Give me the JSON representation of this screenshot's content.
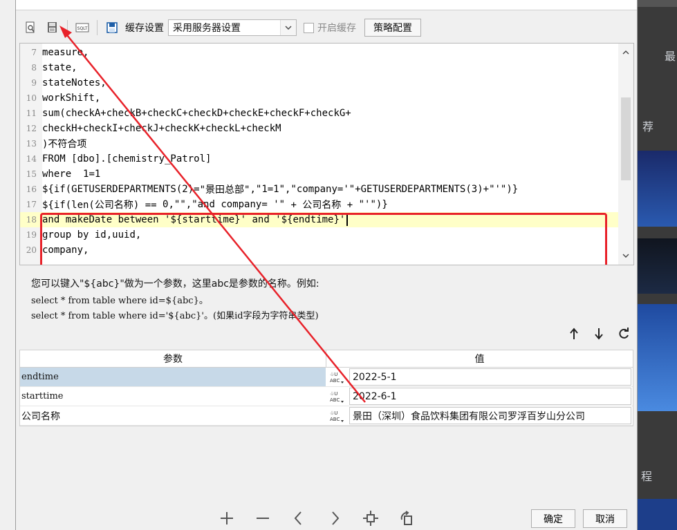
{
  "toolbar": {
    "cache_label": "缓存设置",
    "cache_select": "采用服务器设置",
    "enable_cache": "开启缓存",
    "strategy_button": "策略配置",
    "sql_icon_text": "SQLT"
  },
  "editor": {
    "lines": [
      {
        "n": "7",
        "text": "measure,"
      },
      {
        "n": "8",
        "text": "state,"
      },
      {
        "n": "9",
        "text": "stateNotes,"
      },
      {
        "n": "10",
        "text": "workShift,"
      },
      {
        "n": "11",
        "fn": "sum",
        "rest": "(checkA+checkB+checkC+checkD+checkE+checkF+checkG+"
      },
      {
        "n": "12",
        "text": "checkH+checkI+checkJ+checkK+checkL+checkM"
      },
      {
        "n": "13",
        "text": ")不符合项"
      },
      {
        "n": "14",
        "kw": "FROM",
        "grey": " [dbo].[chemistry_Patrol]"
      },
      {
        "n": "15",
        "kw": "where",
        "num": "  1=1"
      },
      {
        "n": "16",
        "p1": "${if(GETUSERDEPARTMENTS(",
        "num1": "2",
        "p2": ")=",
        "s1": "\"景田总部\"",
        "p3": ",",
        "s2": "\"1=1\"",
        "p4": ",",
        "s3": "\"company='\"",
        "p5": "+GETUSERDEPARTMENTS(",
        "num2": "3",
        "p6": ")+",
        "s4": "\"'\"",
        "p7": ")}"
      },
      {
        "n": "17",
        "p1": "${if(len(公司名称) == ",
        "num1": "0",
        "p2": ",",
        "s1": "\"\"",
        "p3": ",",
        "s2": "\"and company= '\"",
        "p4": " + 公司名称 + ",
        "s3": "\"'\"",
        "p5": ")}"
      },
      {
        "n": "18",
        "kw1": "and",
        "t1": " makeDate ",
        "kw2": "between",
        "s1": " '${starttime}' ",
        "kw3": "and",
        "s2": " '${endtime}'"
      },
      {
        "n": "19",
        "kw": "group by",
        "text": " id,uuid,"
      },
      {
        "n": "20",
        "text": "company,"
      }
    ]
  },
  "hint": {
    "line1": "您可以键入\"${abc}\"做为一个参数，这里abc是参数的名称。例如:",
    "line2": "select * from table where id=${abc}。",
    "line3": "select * from table where id='${abc}'。(如果id字段为字符串类型)"
  },
  "params": {
    "header_name": "参数",
    "header_value": "值",
    "rows": [
      {
        "name": "endtime",
        "value": "2022-5-1"
      },
      {
        "name": "starttime",
        "value": "2022-6-1"
      },
      {
        "name": "公司名称",
        "value": "景田（深圳）食品饮料集团有限公司罗浮百岁山分公司"
      }
    ]
  },
  "buttons": {
    "ok": "确定",
    "cancel": "取消"
  },
  "background": {
    "right_texts": [
      "最",
      "荐",
      "程"
    ]
  },
  "colors": {
    "keyword": "#0000ee",
    "string": "#a020f0",
    "number": "#d10000",
    "annotation": "#e8222a",
    "selection": "#c7d9e8"
  }
}
